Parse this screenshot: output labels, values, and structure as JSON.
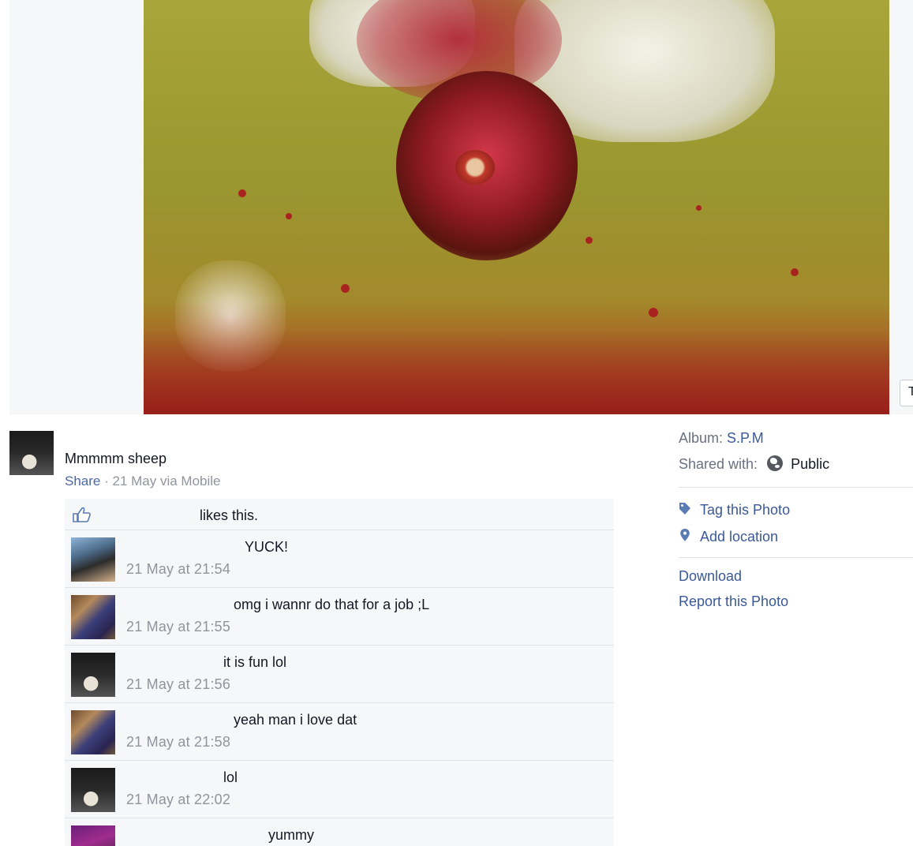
{
  "photo_viewer": {
    "side_chip_label": "T"
  },
  "post": {
    "caption": "Mmmmm sheep",
    "share_label": "Share",
    "separator": " · ",
    "posted_meta": "21 May via Mobile",
    "likes_text": "likes this."
  },
  "comments": [
    {
      "text": "YUCK!",
      "time": "21 May at 21:54",
      "avatar": "boys-photo"
    },
    {
      "text": "omg i wannr do that for a job ;L",
      "time": "21 May at 21:55",
      "avatar": "girls-photo"
    },
    {
      "text": "it is fun lol",
      "time": "21 May at 21:56",
      "avatar": "owner-photo"
    },
    {
      "text": "yeah man i love dat",
      "time": "21 May at 21:58",
      "avatar": "girls-photo"
    },
    {
      "text": "lol",
      "time": "21 May at 22:02",
      "avatar": "owner-photo"
    },
    {
      "text": "yummy",
      "time": "",
      "avatar": "purple-photo"
    }
  ],
  "side_panel": {
    "album_label": "Album:",
    "album_name": "S.P.M",
    "shared_with_label": "Shared with:",
    "privacy": "Public",
    "tag_photo": "Tag this Photo",
    "add_location": "Add location",
    "download": "Download",
    "report": "Report this Photo"
  },
  "colors": {
    "link": "#3b5998",
    "meta_grey": "#90949c",
    "comment_bg": "#f6f7f9"
  },
  "icons": [
    "thumbs-up-icon",
    "globe-icon",
    "tag-icon",
    "location-pin-icon"
  ]
}
